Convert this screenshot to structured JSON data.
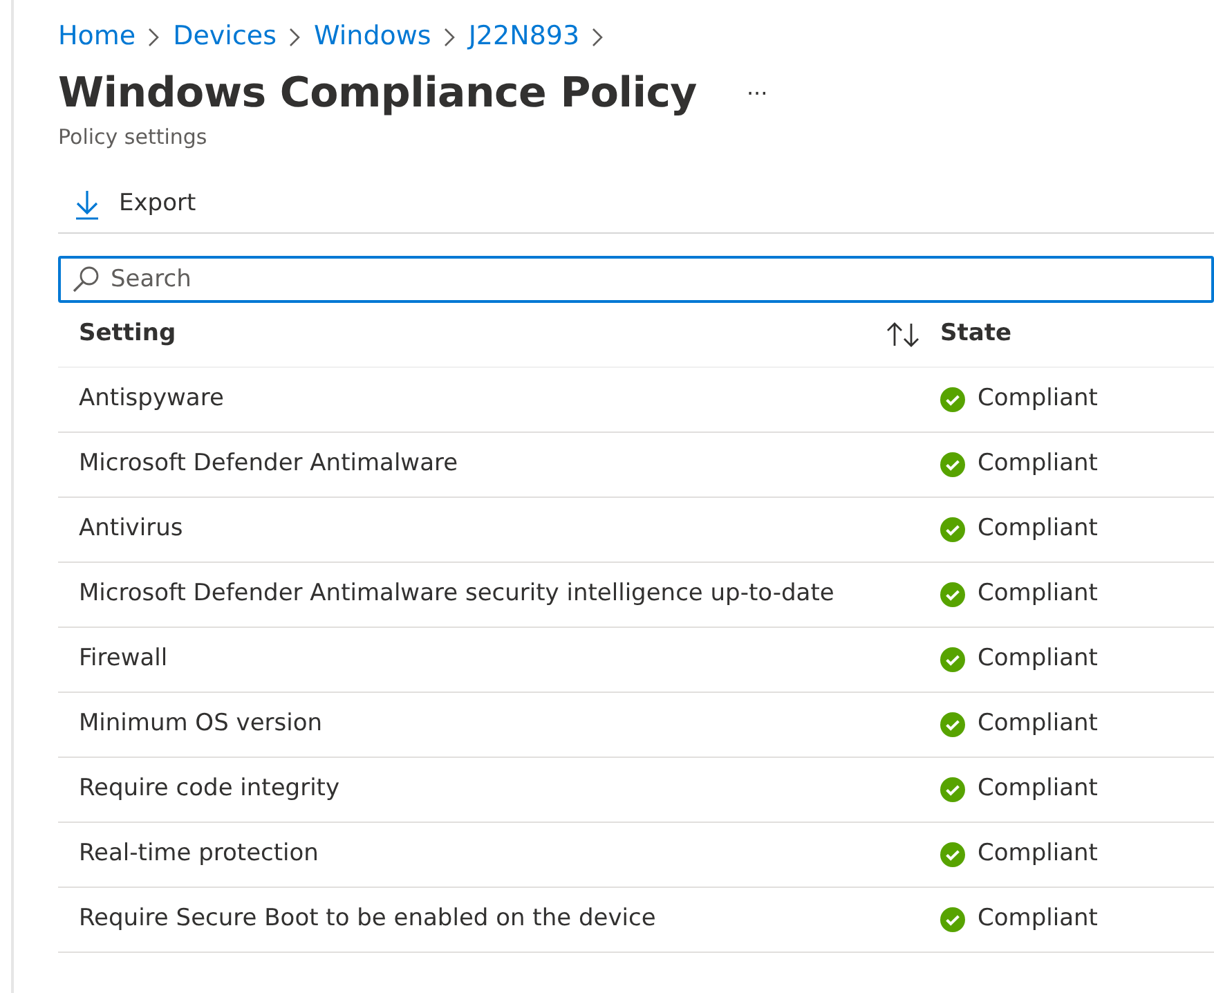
{
  "breadcrumb": [
    "Home",
    "Devices",
    "Windows",
    "J22N893"
  ],
  "title": "Windows Compliance Policy",
  "more_menu": "···",
  "subtitle": "Policy settings",
  "toolbar": [
    {
      "label": "Export"
    }
  ],
  "search": {
    "placeholder": "Search"
  },
  "table": {
    "columns": [
      "Setting",
      "State"
    ],
    "rows": [
      {
        "setting": "Antispyware",
        "state": "Compliant",
        "kind": "compliant"
      },
      {
        "setting": "Microsoft Defender Antimalware",
        "state": "Compliant",
        "kind": "compliant"
      },
      {
        "setting": "Antivirus",
        "state": "Compliant",
        "kind": "compliant"
      },
      {
        "setting": "Microsoft Defender Antimalware security intelligence up-to-date",
        "state": "Compliant",
        "kind": "compliant"
      },
      {
        "setting": "Firewall",
        "state": "Compliant",
        "kind": "compliant"
      },
      {
        "setting": "Minimum OS version",
        "state": "Compliant",
        "kind": "compliant"
      },
      {
        "setting": "Require code integrity",
        "state": "Compliant",
        "kind": "compliant"
      },
      {
        "setting": "Real-time protection",
        "state": "Compliant",
        "kind": "compliant"
      },
      {
        "setting": "Require Secure Boot to be enabled on the device",
        "state": "Compliant",
        "kind": "compliant"
      }
    ]
  }
}
